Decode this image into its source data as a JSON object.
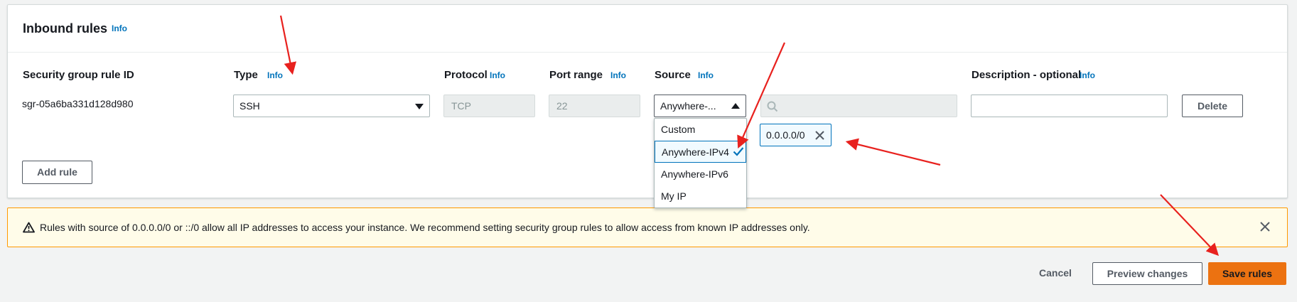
{
  "panel": {
    "title": "Inbound rules",
    "title_info": "Info"
  },
  "columns": {
    "rule_id": "Security group rule ID",
    "type": "Type",
    "type_info": "Info",
    "protocol": "Protocol",
    "protocol_info": "Info",
    "port_range": "Port range",
    "port_range_info": "Info",
    "source": "Source",
    "source_info": "Info",
    "description": "Description - optional",
    "description_info": "Info"
  },
  "rule": {
    "id": "sgr-05a6ba331d128d980",
    "type": "SSH",
    "protocol": "TCP",
    "port_range": "22",
    "source_selected": "Anywhere-...",
    "source_options": [
      "Custom",
      "Anywhere-IPv4",
      "Anywhere-IPv6",
      "My IP"
    ],
    "cidr_token": "0.0.0.0/0",
    "delete_label": "Delete"
  },
  "add_rule_label": "Add rule",
  "warning": {
    "text": "Rules with source of 0.0.0.0/0 or ::/0 allow all IP addresses to access your instance. We recommend setting security group rules to allow access from known IP addresses only."
  },
  "footer": {
    "cancel": "Cancel",
    "preview": "Preview changes",
    "save": "Save rules"
  },
  "colors": {
    "accent": "#0073bb",
    "primary": "#ec7211",
    "warning_border": "#ff9900",
    "annotation": "#e8211e"
  }
}
